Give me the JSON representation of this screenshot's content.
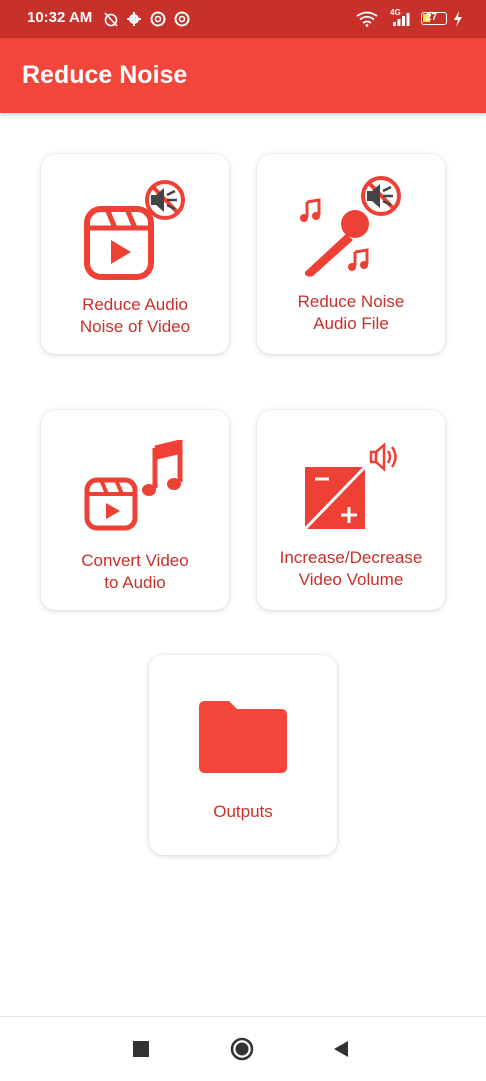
{
  "status_bar": {
    "time": "10:32 AM",
    "network": "4G",
    "battery": "27",
    "icons": [
      "alarm-off-icon",
      "settings-icon",
      "app-icon",
      "app-icon",
      "wifi-icon",
      "signal-icon",
      "battery-icon",
      "charging-icon"
    ]
  },
  "app_bar": {
    "title": "Reduce Noise"
  },
  "cards": [
    {
      "label": "Reduce Audio\nNoise of Video",
      "icon": "video-mute-icon"
    },
    {
      "label": "Reduce Noise\nAudio File",
      "icon": "microphone-mute-icon"
    },
    {
      "label": "Convert Video\nto Audio",
      "icon": "video-to-music-icon"
    },
    {
      "label": "Increase/Decrease\nVideo Volume",
      "icon": "volume-adjust-icon"
    },
    {
      "label": "Outputs",
      "icon": "folder-icon"
    }
  ],
  "navigation_bar": {
    "buttons": [
      "recents-button",
      "home-button",
      "back-button"
    ]
  },
  "colors": {
    "primary": "#f2463b",
    "status_bar": "#c8302a",
    "label": "#c8302a",
    "icon": "#ef4035"
  }
}
